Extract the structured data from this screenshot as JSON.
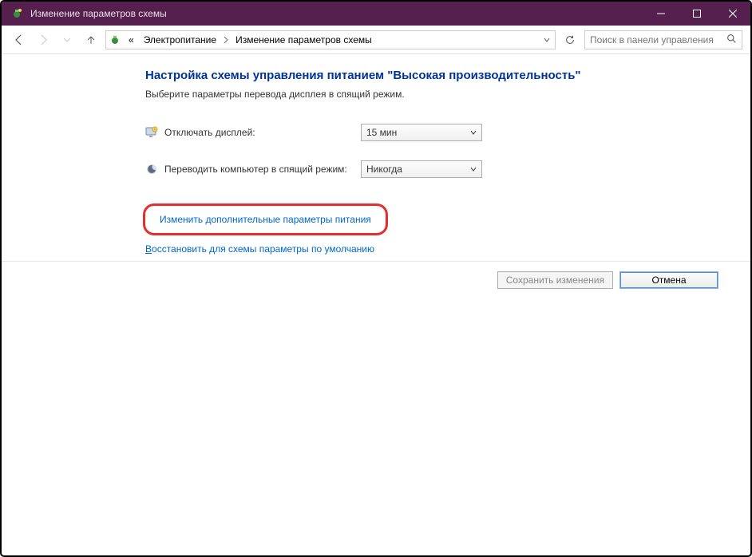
{
  "window": {
    "title": "Изменение параметров схемы"
  },
  "nav": {
    "crumb_root": "«",
    "crumb_1": "Электропитание",
    "crumb_2": "Изменение параметров схемы",
    "search_placeholder": "Поиск в панели управления"
  },
  "page": {
    "heading": "Настройка схемы управления питанием \"Высокая производительность\"",
    "subhead": "Выберите параметры перевода дисплея в спящий режим."
  },
  "settings": {
    "display_off_label": "Отключать дисплей:",
    "display_off_value": "15 мин",
    "sleep_label": "Переводить компьютер в спящий режим:",
    "sleep_value": "Никогда"
  },
  "links": {
    "advanced": "Изменить дополнительные параметры питания",
    "restore": "Восстановить для схемы параметры по умолчанию"
  },
  "buttons": {
    "save": "Сохранить изменения",
    "cancel": "Отмена"
  }
}
